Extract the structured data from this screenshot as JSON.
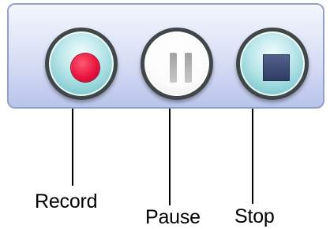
{
  "controls": {
    "record": {
      "label": "Record",
      "icon": "record-dot-icon",
      "color": "#ea1540"
    },
    "pause": {
      "label": "Pause",
      "icon": "pause-icon",
      "color": "#b0b0b0"
    },
    "stop": {
      "label": "Stop",
      "icon": "stop-square-icon",
      "color": "#3a4670"
    }
  },
  "colors": {
    "panel_border": "#8f9fd0",
    "button_ring": "#3f4749",
    "button_teal": "#7dc9cf"
  }
}
